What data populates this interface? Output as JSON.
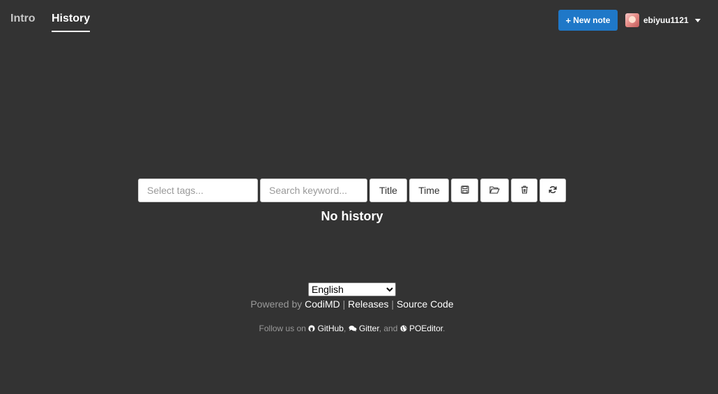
{
  "nav": {
    "tabs": [
      {
        "label": "Intro",
        "active": false
      },
      {
        "label": "History",
        "active": true
      }
    ],
    "new_note_label": "New note",
    "username": "ebiyuu1121"
  },
  "toolbar": {
    "tags_placeholder": "Select tags...",
    "keyword_placeholder": "Search keyword...",
    "title_label": "Title",
    "time_label": "Time",
    "icons": [
      "save-icon",
      "folder-open-icon",
      "trash-icon",
      "refresh-icon"
    ]
  },
  "main": {
    "empty_text": "No history"
  },
  "footer": {
    "language_selected": "English",
    "powered_by": "Powered by",
    "codimd": "CodiMD",
    "sep": "|",
    "releases": "Releases",
    "source_code": "Source Code",
    "follow_prefix": "Follow us on",
    "github": "GitHub",
    "gitter": "Gitter",
    "and": ", and",
    "poeditor": "POEditor",
    "comma": ",",
    "period": "."
  },
  "colors": {
    "background": "#333333",
    "accent": "#1f78c8",
    "muted_text": "#999999"
  }
}
